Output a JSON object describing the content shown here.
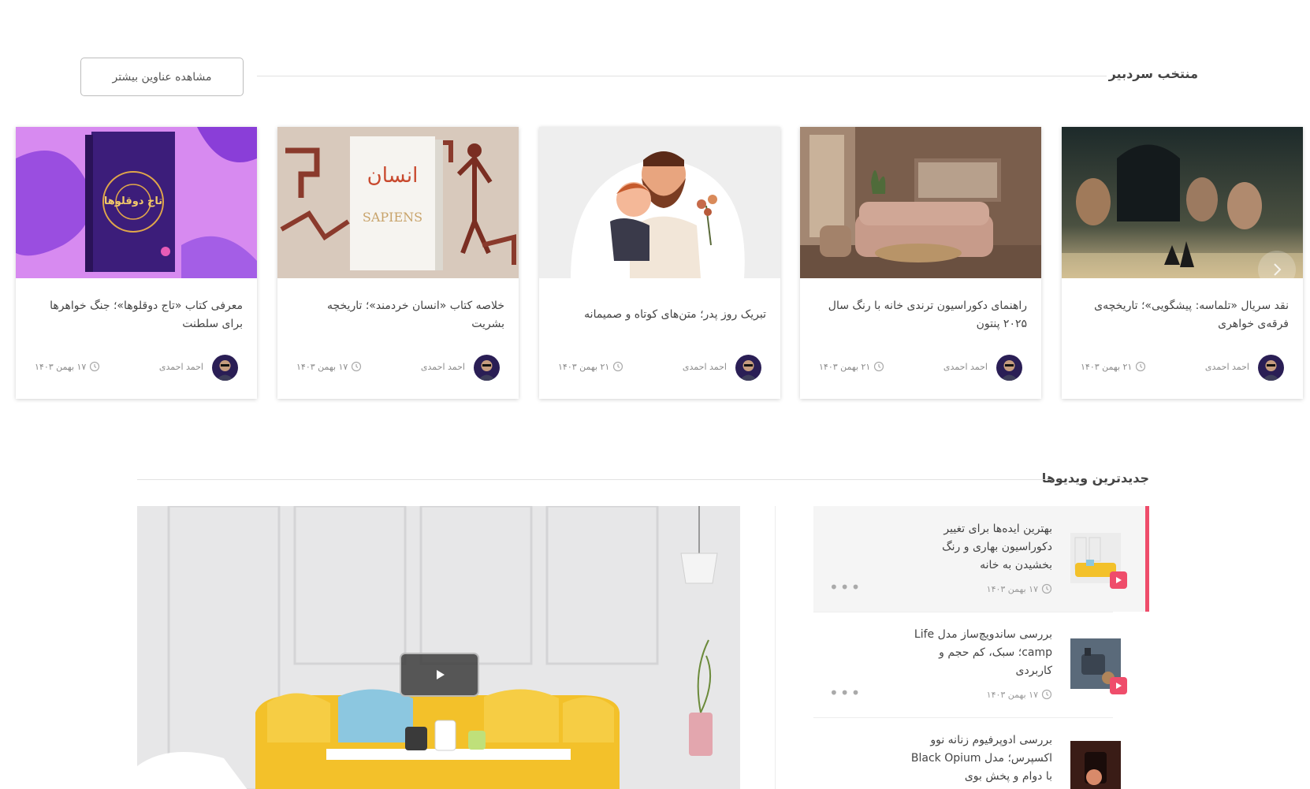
{
  "editors_pick": {
    "title": "منتخب سردبیر",
    "more_button": "مشاهده عناوین بیشتر",
    "cards": [
      {
        "title": "نقد سریال «تلماسه: پیشگویی»؛ تاریخچه‌ی فرقه‌ی خواهری",
        "author": "احمد احمدی",
        "date": "۲۱ بهمن ۱۴۰۳",
        "image": "dune-prophecy-poster"
      },
      {
        "title": "راهنمای دکوراسیون ترندی خانه با رنگ سال ۲۰۲۵ پنتون",
        "author": "احمد احمدی",
        "date": "۲۱ بهمن ۱۴۰۳",
        "image": "living-room-mocha"
      },
      {
        "title": "تبریک روز پدر؛ متن‌های کوتاه و صمیمانه",
        "author": "احمد احمدی",
        "date": "۲۱ بهمن ۱۴۰۳",
        "image": "father-daughter-illustration"
      },
      {
        "title": "خلاصه کتاب «انسان خردمند»؛ تاریخچه بشریت",
        "author": "احمد احمدی",
        "date": "۱۷ بهمن ۱۴۰۳",
        "image": "sapiens-book"
      },
      {
        "title": "معرفی کتاب «تاج دوقلوها»؛ جنگ خواهرها برای سلطنت",
        "author": "احمد احمدی",
        "date": "۱۷ بهمن ۱۴۰۳",
        "image": "twin-crown-book"
      }
    ]
  },
  "latest_videos": {
    "title": "جدیدترین ویدیوها",
    "items": [
      {
        "title": "بهترین ایده‌ها برای تغییر دکوراسیون بهاری و رنگ بخشیدن به خانه",
        "date": "۱۷ بهمن ۱۴۰۳",
        "more": "•••",
        "active": true
      },
      {
        "title": "بررسی ساندویچ‌ساز مدل Life camp؛ سبک، کم حجم و کاربردی",
        "date": "۱۷ بهمن ۱۴۰۳",
        "more": "•••",
        "active": false
      },
      {
        "title": "بررسی ادوپرفیوم زنانه نوو اکسپرس؛ مدل Black Opium با دوام و پخش بوی",
        "date": "",
        "more": "",
        "active": false
      }
    ]
  },
  "colors": {
    "accent": "#ef4d6b",
    "text": "#444444",
    "muted": "#8a8a8a"
  }
}
